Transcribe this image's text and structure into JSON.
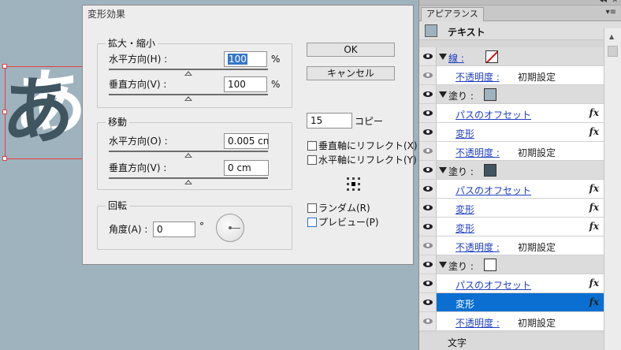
{
  "artwork": {
    "glyph": "あ"
  },
  "dialog": {
    "title": "変形効果",
    "scale": {
      "title": "拡大・縮小",
      "horizontal_label": "水平方向(H) :",
      "horizontal_value": "100",
      "horizontal_unit": "%",
      "horizontal_slider": 0.5,
      "vertical_label": "垂直方向(V) :",
      "vertical_value": "100",
      "vertical_unit": "%",
      "vertical_slider": 0.5
    },
    "move": {
      "title": "移動",
      "horizontal_label": "水平方向(O) :",
      "horizontal_value": "0.005 cn",
      "horizontal_slider": 0.5,
      "vertical_label": "垂直方向(V) :",
      "vertical_value": "0 cm",
      "vertical_slider": 0.5
    },
    "rotate": {
      "title": "回転",
      "angle_label": "角度(A) :",
      "angle_value": "0",
      "angle_unit": "°"
    },
    "ok_label": "OK",
    "cancel_label": "キャンセル",
    "copies_value": "15",
    "copies_label": "コピー",
    "reflect_vertical_label": "垂直軸にリフレクト(X)",
    "reflect_horizontal_label": "水平軸にリフレクト(Y)",
    "random_label": "ランダム(R)",
    "preview_label": "プレビュー(P)"
  },
  "panel": {
    "tab_label": "アピアランス",
    "double_arrow": "◂◂",
    "close": "✕",
    "menu_glyph": "▾≡",
    "header_title": "テキスト",
    "footer_label": "文字",
    "rows": [
      {
        "kind": "group",
        "label": "線 :",
        "link": true,
        "swatch": "none",
        "eye": "dark"
      },
      {
        "kind": "item",
        "label": "不透明度 :",
        "value": "初期設定",
        "eye": "dim"
      },
      {
        "kind": "group",
        "label": "塗り :",
        "swatch": "#9fb3bf",
        "eye": "dark"
      },
      {
        "kind": "item",
        "label": "パスのオフセット",
        "fx": "fx",
        "eye": "dark"
      },
      {
        "kind": "item",
        "label": "変形",
        "fx": "fx",
        "eye": "dark"
      },
      {
        "kind": "item",
        "label": "不透明度 :",
        "value": "初期設定",
        "eye": "dim"
      },
      {
        "kind": "group",
        "label": "塗り :",
        "swatch": "#3f5560",
        "eye": "dark"
      },
      {
        "kind": "item",
        "label": "パスのオフセット",
        "fx": "fx",
        "eye": "dark"
      },
      {
        "kind": "item",
        "label": "変形",
        "fx": "fx",
        "eye": "dark"
      },
      {
        "kind": "item",
        "label": "変形",
        "fx": "fx",
        "eye": "dark"
      },
      {
        "kind": "item",
        "label": "不透明度 :",
        "value": "初期設定",
        "eye": "dim"
      },
      {
        "kind": "group",
        "label": "塗り :",
        "swatch": "#ffffff",
        "eye": "dark"
      },
      {
        "kind": "item",
        "label": "パスのオフセット",
        "fx": "fx",
        "eye": "dark"
      },
      {
        "kind": "item",
        "label": "変形",
        "fx": "fx",
        "eye": "dark",
        "selected": true
      },
      {
        "kind": "item",
        "label": "不透明度 :",
        "value": "初期設定",
        "eye": "dim"
      }
    ]
  },
  "colors": {
    "canvas": "#9fb3bf",
    "glyph_dark": "#3f5560",
    "selection": "#e04040",
    "row_selected": "#0a6fd0",
    "link": "#1f3fc1"
  }
}
